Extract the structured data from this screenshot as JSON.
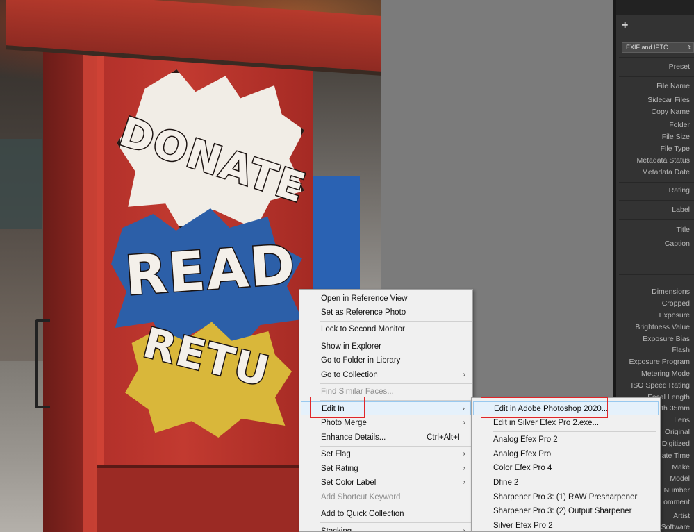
{
  "photo": {
    "painted_words": [
      "DONATE",
      "READ",
      "RETU"
    ]
  },
  "right_panel": {
    "add_symbol": "+",
    "metadata_set": "EXIF and IPTC",
    "select_arrow": "⇕",
    "fields": [
      "Preset",
      "File Name",
      "Sidecar Files",
      "Copy Name",
      "Folder",
      "File Size",
      "File Type",
      "Metadata Status",
      "Metadata Date",
      "Rating",
      "Label",
      "Title",
      "Caption",
      "Dimensions",
      "Cropped",
      "Exposure",
      "Brightness Value",
      "Exposure Bias",
      "Flash",
      "Exposure Program",
      "Metering Mode",
      "ISO Speed Rating",
      "Focal Length",
      "th 35mm",
      "Lens",
      "Original",
      "Digitized",
      "ate Time",
      "Make",
      "Model",
      "Number",
      "omment",
      "Artist",
      "Software"
    ]
  },
  "context_menu": {
    "items": [
      {
        "label": "Open in Reference View"
      },
      {
        "label": "Set as Reference Photo"
      },
      {
        "label": "Lock to Second Monitor"
      },
      {
        "label": "Show in Explorer"
      },
      {
        "label": "Go to Folder in Library"
      },
      {
        "label": "Go to Collection",
        "arrow": "›"
      },
      {
        "label": "Find Similar Faces..."
      },
      {
        "label": "Edit In",
        "arrow": "›"
      },
      {
        "label": "Photo Merge",
        "arrow": "›"
      },
      {
        "label": "Enhance Details...",
        "shortcut": "Ctrl+Alt+I"
      },
      {
        "label": "Set Flag",
        "arrow": "›"
      },
      {
        "label": "Set Rating",
        "arrow": "›"
      },
      {
        "label": "Set Color Label",
        "arrow": "›"
      },
      {
        "label": "Add Shortcut Keyword"
      },
      {
        "label": "Add to Quick Collection"
      },
      {
        "label": "Stacking",
        "arrow": "›"
      }
    ]
  },
  "edit_in_submenu": {
    "items": [
      {
        "label": "Edit in Adobe Photoshop 2020..."
      },
      {
        "label": "Edit in Silver Efex Pro 2.exe..."
      },
      {
        "label": "Analog Efex Pro 2"
      },
      {
        "label": "Analog Efex Pro"
      },
      {
        "label": "Color Efex Pro 4"
      },
      {
        "label": "Dfine 2"
      },
      {
        "label": "Sharpener Pro 3: (1) RAW Presharpener"
      },
      {
        "label": "Sharpener Pro 3: (2) Output Sharpener"
      },
      {
        "label": "Silver Efex Pro 2"
      }
    ]
  },
  "colors": {
    "highlight_bg": "#e5f1fb",
    "highlight_border": "#99c9ef",
    "annotation_red": "#e0262a"
  }
}
